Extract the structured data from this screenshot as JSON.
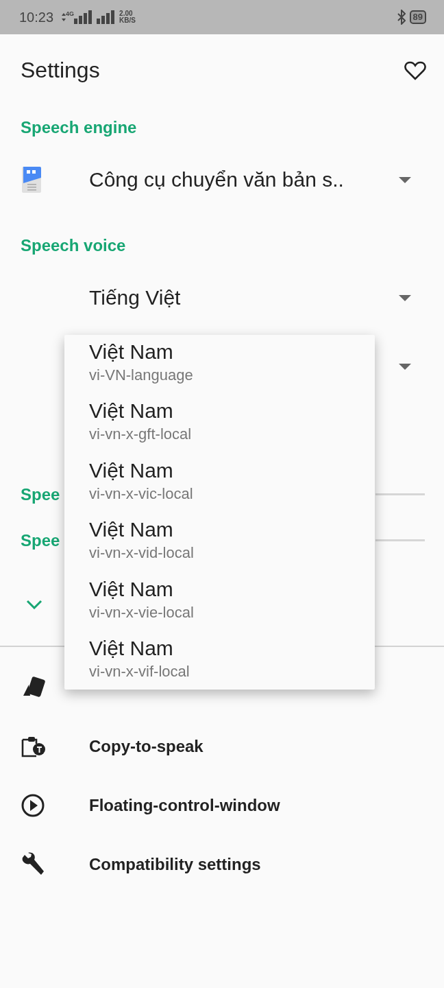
{
  "status_bar": {
    "time": "10:23",
    "network": "4G",
    "speed_value": "2.00",
    "speed_unit": "KB/S",
    "battery": "89"
  },
  "header": {
    "title": "Settings"
  },
  "speech_engine": {
    "title": "Speech engine",
    "value": "Công cụ chuyển văn bản s.."
  },
  "speech_voice": {
    "title": "Speech voice",
    "language": "Tiếng Việt"
  },
  "sliders": [
    {
      "label": "Spee"
    },
    {
      "label": "Spee"
    }
  ],
  "menu_items": [
    {
      "title": "Việt Nam",
      "subtitle": "vi-VN-language"
    },
    {
      "title": "Việt Nam",
      "subtitle": "vi-vn-x-gft-local"
    },
    {
      "title": "Việt Nam",
      "subtitle": "vi-vn-x-vic-local"
    },
    {
      "title": "Việt Nam",
      "subtitle": "vi-vn-x-vid-local"
    },
    {
      "title": "Việt Nam",
      "subtitle": "vi-vn-x-vie-local"
    },
    {
      "title": "Việt Nam",
      "subtitle": "vi-vn-x-vif-local"
    }
  ],
  "options": [
    {
      "kind": "theme"
    },
    {
      "kind": "clipboard",
      "label": "Copy-to-speak"
    },
    {
      "kind": "play",
      "label": "Floating-control-window"
    },
    {
      "kind": "wrench",
      "label": "Compatibility settings"
    }
  ]
}
